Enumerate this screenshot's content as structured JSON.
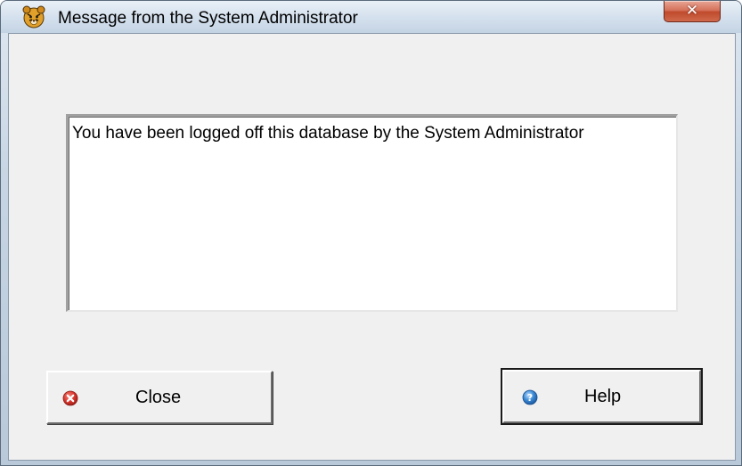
{
  "window": {
    "title": "Message from the System Administrator",
    "app_icon": "tiger-icon",
    "close_control": "close-icon"
  },
  "message": {
    "text": "You have been logged off this database by the System Administrator"
  },
  "buttons": {
    "close_label": "Close",
    "close_icon": "error-circle-icon",
    "help_label": "Help",
    "help_icon": "question-circle-icon"
  },
  "colors": {
    "dialog_background": "#f0f0f0",
    "close_icon_red": "#d9342b",
    "help_icon_blue": "#3c8ad6",
    "titlebar_close_red": "#c04a2c"
  }
}
